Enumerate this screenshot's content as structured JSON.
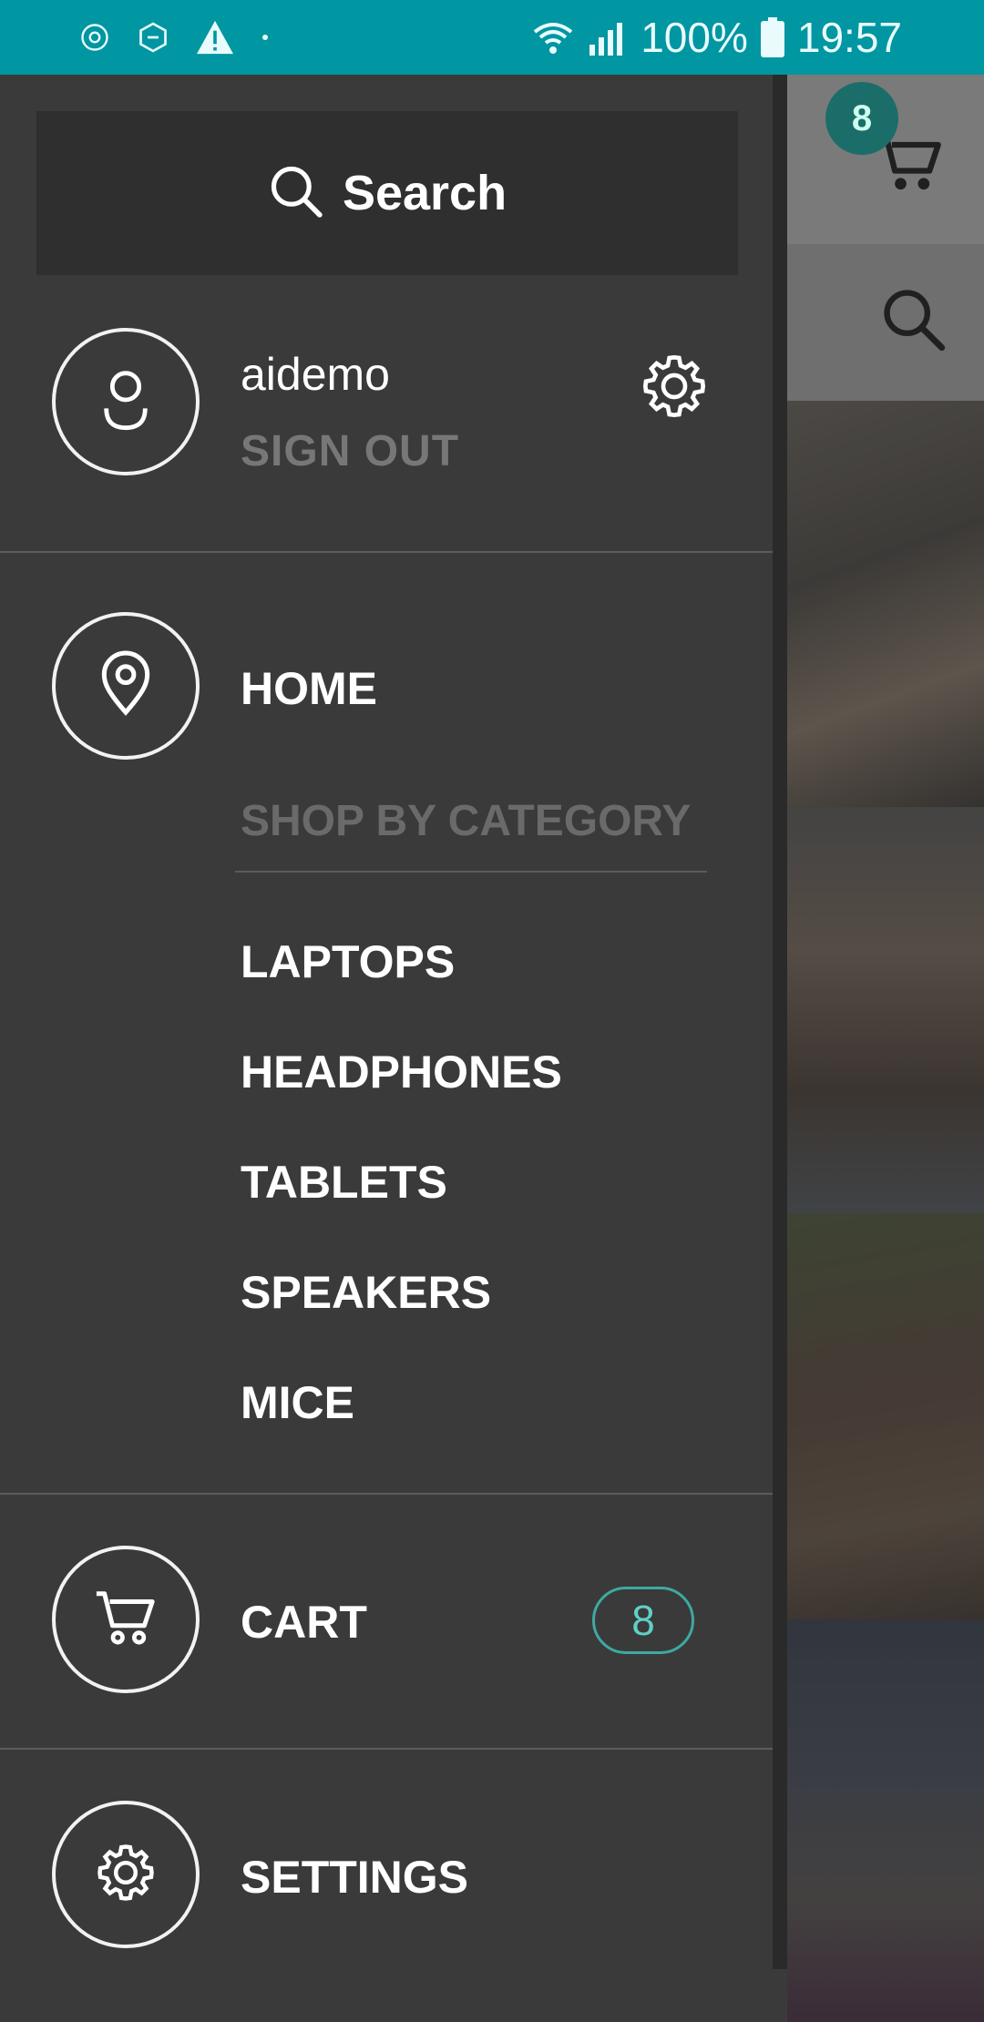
{
  "status_bar": {
    "battery": "100%",
    "time": "19:57",
    "icons": [
      "settings-gear-icon",
      "app-hex-icon",
      "warning-icon",
      "dot-icon",
      "wifi-icon",
      "signal-icon",
      "battery-icon"
    ],
    "bg_color": "#0096a2"
  },
  "drawer": {
    "search": {
      "label": "Search"
    },
    "user": {
      "name": "aidemo",
      "sign_out": "SIGN OUT"
    },
    "nav": {
      "home": "HOME",
      "category_heading": "SHOP BY CATEGORY",
      "categories": [
        "LAPTOPS",
        "HEADPHONES",
        "TABLETS",
        "SPEAKERS",
        "MICE"
      ],
      "cart": "CART",
      "cart_count": "8",
      "settings": "SETTINGS"
    }
  },
  "background_app": {
    "cart_badge": "8"
  },
  "colors": {
    "drawer_bg": "#3a3a3a",
    "accent": "#3fa8a2",
    "muted_text": "#777777"
  }
}
